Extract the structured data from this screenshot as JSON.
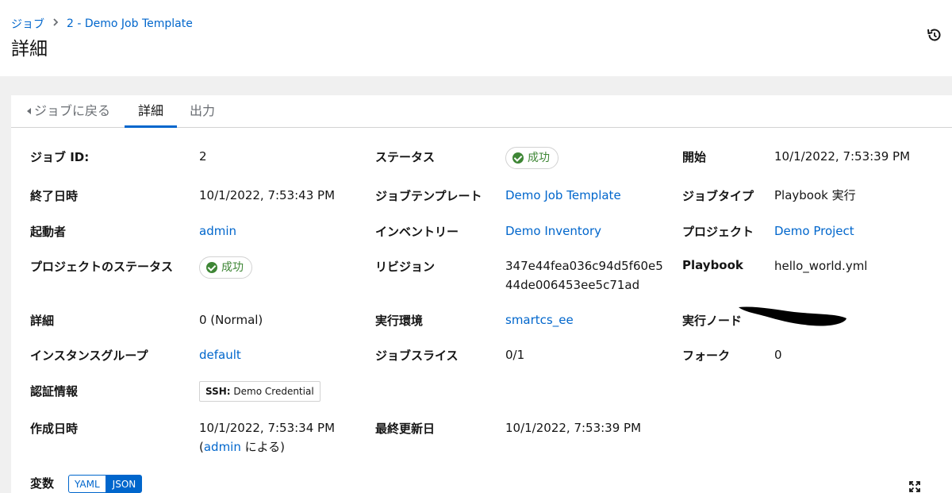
{
  "header": {
    "breadcrumb": {
      "root": "ジョブ",
      "current": "2 - Demo Job Template"
    },
    "title": "詳細"
  },
  "tabs": {
    "back": "ジョブに戻る",
    "details": "詳細",
    "output": "出力"
  },
  "details": {
    "job_id": {
      "label": "ジョブ ID:",
      "value": "2"
    },
    "status": {
      "label": "ステータス",
      "value": "成功"
    },
    "started": {
      "label": "開始",
      "value": "10/1/2022, 7:53:39 PM"
    },
    "finished": {
      "label": "終了日時",
      "value": "10/1/2022, 7:53:43 PM"
    },
    "job_template": {
      "label": "ジョブテンプレート",
      "value": "Demo Job Template"
    },
    "job_type": {
      "label": "ジョブタイプ",
      "value": "Playbook 実行"
    },
    "launched_by": {
      "label": "起動者",
      "value": "admin"
    },
    "inventory": {
      "label": "インベントリー",
      "value": "Demo Inventory"
    },
    "project": {
      "label": "プロジェクト",
      "value": "Demo Project"
    },
    "project_status": {
      "label": "プロジェクトのステータス",
      "value": "成功"
    },
    "revision": {
      "label": "リビジョン",
      "value_line1": "347e44fea036c94d5f60e5",
      "value_line2": "44de006453ee5c71ad"
    },
    "playbook": {
      "label": "Playbook",
      "value": "hello_world.yml"
    },
    "verbosity": {
      "label": "詳細",
      "value": "0 (Normal)"
    },
    "execution_environment": {
      "label": "実行環境",
      "value": "smartcs_ee"
    },
    "execution_node": {
      "label": "実行ノード"
    },
    "instance_group": {
      "label": "インスタンスグループ",
      "value": "default"
    },
    "job_slice": {
      "label": "ジョブスライス",
      "value": "0/1"
    },
    "forks": {
      "label": "フォーク",
      "value": "0"
    },
    "credentials": {
      "label": "認証情報",
      "chip_type": "SSH:",
      "chip_name": "Demo Credential"
    },
    "created": {
      "label": "作成日時",
      "value": "10/1/2022, 7:53:34 PM",
      "by_open": "(",
      "by_user": "admin",
      "by_suffix": " による)"
    },
    "modified": {
      "label": "最終更新日",
      "value": "10/1/2022, 7:53:39 PM"
    },
    "variables": {
      "label": "変数",
      "yaml": "YAML",
      "json": "JSON",
      "selected": "JSON"
    }
  },
  "colors": {
    "link": "#0066cc",
    "success": "#3e8635",
    "accent": "#0066cc"
  },
  "icons": {
    "history": "history-icon",
    "expand": "expand-icon",
    "success": "check-circle-icon",
    "back": "caret-left-icon"
  }
}
